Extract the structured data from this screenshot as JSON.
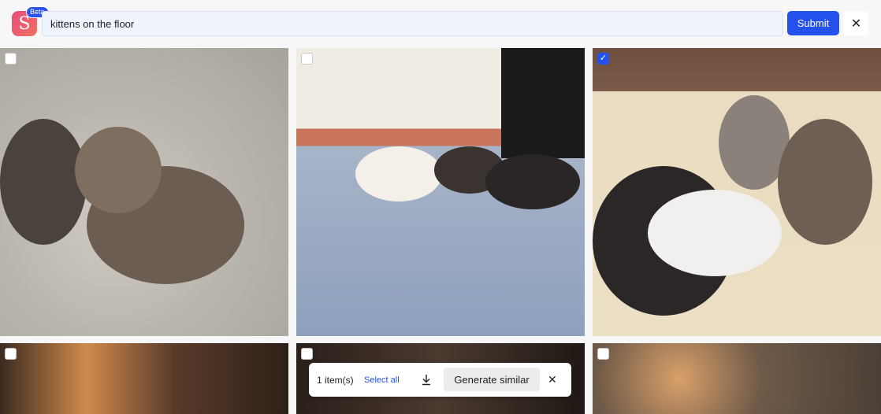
{
  "header": {
    "logo_letter": "S",
    "badge": "Beta",
    "search_value": "kittens on the floor",
    "submit_label": "Submit",
    "close_symbol": "✕"
  },
  "grid": {
    "tiles": [
      {
        "checked": false
      },
      {
        "checked": false
      },
      {
        "checked": true
      },
      {
        "checked": false
      },
      {
        "checked": false
      },
      {
        "checked": false
      }
    ],
    "check_symbol": "✓"
  },
  "selection_toolbar": {
    "count_label": "1 item(s)",
    "select_all_label": "Select all",
    "generate_label": "Generate similar",
    "close_symbol": "✕"
  },
  "colors": {
    "accent": "#2451eb",
    "logo_start": "#e84a7e",
    "logo_end": "#f2715f"
  },
  "icons": [
    "download-icon",
    "close-icon",
    "check-icon"
  ]
}
